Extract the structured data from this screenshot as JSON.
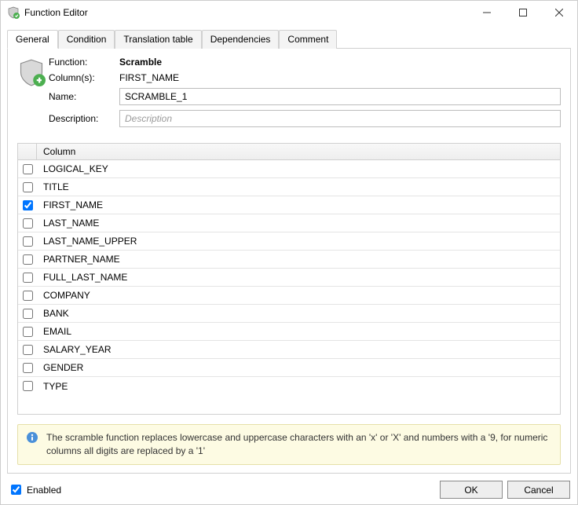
{
  "window": {
    "title": "Function Editor"
  },
  "tabs": [
    {
      "label": "General"
    },
    {
      "label": "Condition"
    },
    {
      "label": "Translation table"
    },
    {
      "label": "Dependencies"
    },
    {
      "label": "Comment"
    }
  ],
  "form": {
    "function_label": "Function:",
    "function_value": "Scramble",
    "columns_label": "Column(s):",
    "columns_value": "FIRST_NAME",
    "name_label": "Name:",
    "name_value": "SCRAMBLE_1",
    "description_label": "Description:",
    "description_placeholder": "Description",
    "description_value": ""
  },
  "grid": {
    "header_col": "Column",
    "rows": [
      {
        "label": "LOGICAL_KEY",
        "checked": false
      },
      {
        "label": "TITLE",
        "checked": false
      },
      {
        "label": "FIRST_NAME",
        "checked": true
      },
      {
        "label": "LAST_NAME",
        "checked": false
      },
      {
        "label": "LAST_NAME_UPPER",
        "checked": false
      },
      {
        "label": "PARTNER_NAME",
        "checked": false
      },
      {
        "label": "FULL_LAST_NAME",
        "checked": false
      },
      {
        "label": "COMPANY",
        "checked": false
      },
      {
        "label": "BANK",
        "checked": false
      },
      {
        "label": "EMAIL",
        "checked": false
      },
      {
        "label": "SALARY_YEAR",
        "checked": false
      },
      {
        "label": "GENDER",
        "checked": false
      },
      {
        "label": "TYPE",
        "checked": false
      }
    ]
  },
  "note": "The scramble function replaces lowercase and uppercase characters with an 'x' or 'X' and numbers with a '9, for numeric columns all digits are replaced by a '1'",
  "footer": {
    "enabled_label": "Enabled",
    "enabled_checked": true,
    "ok_label": "OK",
    "cancel_label": "Cancel"
  }
}
